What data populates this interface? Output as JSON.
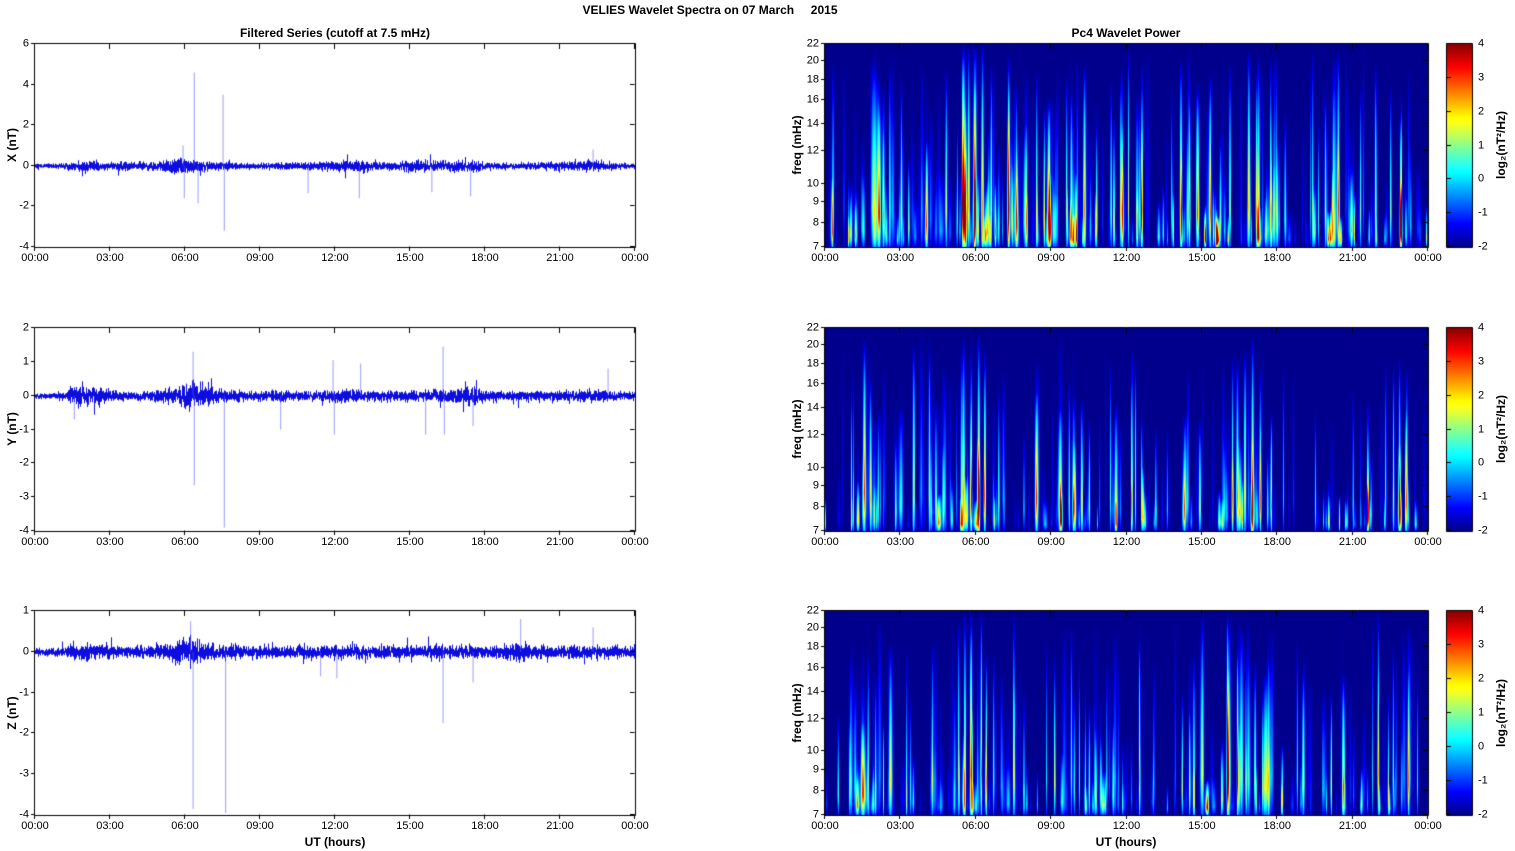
{
  "figure": {
    "title": "VELIES Wavelet Spectra on 07 March     2015"
  },
  "x_axis": {
    "label": "UT (hours)",
    "ticks": [
      "00:00",
      "03:00",
      "06:00",
      "09:00",
      "12:00",
      "15:00",
      "18:00",
      "21:00",
      "00:00"
    ],
    "range_hours": [
      0,
      24
    ]
  },
  "colorbar": {
    "label": "log₂(nT²/Hz)",
    "ticks": [
      4,
      3,
      2,
      1,
      0,
      -1,
      -2
    ],
    "min": -2,
    "max": 4,
    "colormap": "jet"
  },
  "chart_data": [
    {
      "id": "series-x",
      "type": "line",
      "title": "Filtered Series (cutoff at 7.5 mHz)",
      "ylabel": "X (nT)",
      "ylim": [
        -4,
        6
      ],
      "yticks": [
        6,
        4,
        2,
        0,
        -2,
        -4
      ],
      "line_color": "#0000dd",
      "seed": 7,
      "noise_envelope": [
        [
          0,
          0.09
        ],
        [
          1,
          0.1
        ],
        [
          1.4,
          0.18
        ],
        [
          1.8,
          0.26
        ],
        [
          2.4,
          0.22
        ],
        [
          3,
          0.16
        ],
        [
          3.6,
          0.2
        ],
        [
          4.2,
          0.16
        ],
        [
          5,
          0.24
        ],
        [
          5.6,
          0.38
        ],
        [
          6.1,
          0.32
        ],
        [
          6.6,
          0.26
        ],
        [
          7.2,
          0.18
        ],
        [
          8,
          0.15
        ],
        [
          9,
          0.13
        ],
        [
          10,
          0.16
        ],
        [
          11,
          0.16
        ],
        [
          11.6,
          0.2
        ],
        [
          12.2,
          0.26
        ],
        [
          12.8,
          0.28
        ],
        [
          13.4,
          0.2
        ],
        [
          14,
          0.17
        ],
        [
          14.6,
          0.2
        ],
        [
          15.2,
          0.24
        ],
        [
          15.8,
          0.26
        ],
        [
          16.4,
          0.22
        ],
        [
          17,
          0.26
        ],
        [
          17.4,
          0.3
        ],
        [
          18,
          0.16
        ],
        [
          19,
          0.13
        ],
        [
          20,
          0.15
        ],
        [
          21,
          0.16
        ],
        [
          21.6,
          0.2
        ],
        [
          22.2,
          0.24
        ],
        [
          22.7,
          0.2
        ],
        [
          23.2,
          0.14
        ],
        [
          24,
          0.12
        ]
      ],
      "spikes_t_val": [
        [
          5.9,
          1.0
        ],
        [
          5.95,
          -1.6
        ],
        [
          6.35,
          4.6
        ],
        [
          6.5,
          -1.85
        ],
        [
          7.5,
          3.5
        ],
        [
          7.55,
          -3.2
        ],
        [
          10.9,
          -1.35
        ],
        [
          12.95,
          -1.6
        ],
        [
          15.85,
          -1.3
        ],
        [
          17.4,
          -1.5
        ],
        [
          22.3,
          0.8
        ]
      ]
    },
    {
      "id": "series-y",
      "type": "line",
      "title": "",
      "ylabel": "Y (nT)",
      "ylim": [
        -4,
        2
      ],
      "yticks": [
        2,
        1,
        0,
        -1,
        -2,
        -3,
        -4
      ],
      "line_color": "#0000dd",
      "seed": 8,
      "noise_envelope": [
        [
          0,
          0.07
        ],
        [
          1.2,
          0.08
        ],
        [
          1.5,
          0.24
        ],
        [
          1.9,
          0.3
        ],
        [
          2.4,
          0.24
        ],
        [
          3,
          0.16
        ],
        [
          3.8,
          0.12
        ],
        [
          4.6,
          0.12
        ],
        [
          5.4,
          0.18
        ],
        [
          5.9,
          0.28
        ],
        [
          6.3,
          0.34
        ],
        [
          6.8,
          0.28
        ],
        [
          7.4,
          0.16
        ],
        [
          8,
          0.13
        ],
        [
          9,
          0.13
        ],
        [
          9.6,
          0.16
        ],
        [
          10.2,
          0.13
        ],
        [
          11,
          0.13
        ],
        [
          11.8,
          0.16
        ],
        [
          12.4,
          0.18
        ],
        [
          13,
          0.16
        ],
        [
          14,
          0.13
        ],
        [
          15,
          0.13
        ],
        [
          16,
          0.16
        ],
        [
          16.6,
          0.2
        ],
        [
          17.2,
          0.22
        ],
        [
          17.6,
          0.24
        ],
        [
          18.2,
          0.15
        ],
        [
          19,
          0.11
        ],
        [
          20,
          0.12
        ],
        [
          21,
          0.13
        ],
        [
          21.8,
          0.15
        ],
        [
          22.4,
          0.18
        ],
        [
          23,
          0.13
        ],
        [
          24,
          0.1
        ]
      ],
      "spikes_t_val": [
        [
          1.55,
          -0.7
        ],
        [
          6.3,
          1.3
        ],
        [
          6.35,
          -2.65
        ],
        [
          7.55,
          -3.9
        ],
        [
          9.8,
          -1.0
        ],
        [
          11.9,
          1.05
        ],
        [
          11.95,
          -1.15
        ],
        [
          13.0,
          0.95
        ],
        [
          15.6,
          -1.15
        ],
        [
          16.3,
          1.45
        ],
        [
          16.35,
          -1.15
        ],
        [
          17.5,
          -0.9
        ],
        [
          22.9,
          0.8
        ]
      ]
    },
    {
      "id": "series-z",
      "type": "line",
      "title": "",
      "ylabel": "Z (nT)",
      "ylim": [
        -4,
        1
      ],
      "yticks": [
        1,
        0,
        -1,
        -2,
        -3,
        -4
      ],
      "line_color": "#0000dd",
      "seed": 9,
      "noise_envelope": [
        [
          0,
          0.08
        ],
        [
          1,
          0.1
        ],
        [
          1.5,
          0.16
        ],
        [
          2,
          0.18
        ],
        [
          2.6,
          0.15
        ],
        [
          3.4,
          0.12
        ],
        [
          4.2,
          0.13
        ],
        [
          5,
          0.16
        ],
        [
          5.6,
          0.24
        ],
        [
          6.1,
          0.3
        ],
        [
          6.6,
          0.22
        ],
        [
          7.2,
          0.16
        ],
        [
          8,
          0.14
        ],
        [
          9,
          0.13
        ],
        [
          10,
          0.14
        ],
        [
          11,
          0.13
        ],
        [
          12,
          0.14
        ],
        [
          13,
          0.15
        ],
        [
          14,
          0.13
        ],
        [
          15,
          0.13
        ],
        [
          16,
          0.16
        ],
        [
          17,
          0.16
        ],
        [
          18,
          0.13
        ],
        [
          19,
          0.16
        ],
        [
          19.6,
          0.2
        ],
        [
          20.2,
          0.14
        ],
        [
          21,
          0.13
        ],
        [
          22,
          0.15
        ],
        [
          23,
          0.13
        ],
        [
          24,
          0.11
        ]
      ],
      "spikes_t_val": [
        [
          6.2,
          0.75
        ],
        [
          6.3,
          -3.85
        ],
        [
          7.6,
          -3.95
        ],
        [
          11.4,
          -0.6
        ],
        [
          12.05,
          -0.65
        ],
        [
          16.3,
          -1.75
        ],
        [
          17.5,
          -0.75
        ],
        [
          19.4,
          0.8
        ],
        [
          22.3,
          0.6
        ]
      ]
    },
    {
      "id": "spec-x",
      "type": "heatmap",
      "title": "Pc4 Wavelet Power",
      "ylabel": "freq (mHz)",
      "yscale": "log",
      "ylim": [
        7,
        22
      ],
      "yticks": [
        22,
        20,
        18,
        16,
        14,
        12,
        10,
        9,
        8,
        7
      ],
      "clim": [
        -2,
        4
      ],
      "seed": 41,
      "n_streaks": 300,
      "intensity": 1.15,
      "activity_hourly": [
        0.35,
        0.75,
        0.9,
        0.6,
        0.55,
        0.95,
        1.0,
        0.85,
        0.55,
        0.75,
        0.85,
        0.8,
        0.65,
        0.5,
        0.75,
        0.8,
        0.9,
        0.85,
        0.55,
        0.5,
        0.65,
        0.75,
        0.8,
        0.55
      ],
      "streak_events_t_amp_h_w": [
        [
          1.9,
          3.8,
          0.92,
          1.6
        ],
        [
          2.1,
          3.4,
          0.85,
          1.2
        ],
        [
          2.3,
          3.2,
          0.8,
          0.9
        ],
        [
          5.5,
          5.6,
          1,
          1.1
        ],
        [
          5.7,
          5.2,
          1,
          0.8
        ],
        [
          5.95,
          6.0,
          1,
          1.2
        ],
        [
          6.25,
          5.4,
          1,
          0.9
        ],
        [
          6.6,
          4.4,
          0.9,
          0.7
        ],
        [
          7.3,
          5.0,
          0.95,
          0.8
        ],
        [
          7.6,
          4.2,
          0.8,
          0.6
        ],
        [
          8.9,
          3.4,
          0.7,
          0.6
        ],
        [
          9.6,
          3.8,
          0.85,
          0.7
        ],
        [
          10.3,
          4.4,
          0.9,
          0.8
        ],
        [
          10.8,
          3.6,
          0.6,
          0.5
        ],
        [
          11.8,
          3.5,
          0.9,
          0.6
        ],
        [
          12.4,
          3.8,
          0.75,
          0.7
        ],
        [
          12.6,
          4.4,
          0.9,
          0.6
        ],
        [
          14.15,
          5.2,
          0.92,
          0.9
        ],
        [
          14.5,
          3.6,
          0.7,
          0.5
        ],
        [
          15.3,
          4.0,
          0.85,
          0.7
        ],
        [
          16.1,
          4.2,
          0.9,
          0.7
        ],
        [
          16.85,
          5.3,
          0.97,
          0.9
        ],
        [
          17.15,
          4.4,
          0.85,
          0.6
        ],
        [
          19.9,
          3.4,
          0.75,
          0.5
        ],
        [
          21.3,
          3.6,
          0.8,
          0.6
        ],
        [
          21.9,
          4.4,
          0.9,
          0.7
        ],
        [
          22.5,
          4.0,
          0.8,
          0.6
        ],
        [
          22.9,
          4.3,
          0.65,
          0.6
        ],
        [
          23.3,
          3.2,
          0.5,
          0.5
        ]
      ]
    },
    {
      "id": "spec-y",
      "type": "heatmap",
      "title": "",
      "ylabel": "freq (mHz)",
      "yscale": "log",
      "ylim": [
        7,
        22
      ],
      "yticks": [
        22,
        20,
        18,
        16,
        14,
        12,
        10,
        9,
        8,
        7
      ],
      "clim": [
        -2,
        4
      ],
      "seed": 42,
      "n_streaks": 230,
      "intensity": 1.0,
      "activity_hourly": [
        0.3,
        0.8,
        0.7,
        0.5,
        0.4,
        0.85,
        0.9,
        0.55,
        0.4,
        0.65,
        0.7,
        0.6,
        0.55,
        0.45,
        0.5,
        0.55,
        0.85,
        0.8,
        0.45,
        0.35,
        0.45,
        0.5,
        0.7,
        0.6
      ],
      "streak_events_t_amp_h_w": [
        [
          1.55,
          5.4,
          0.95,
          1.0
        ],
        [
          1.8,
          4.6,
          0.75,
          0.7
        ],
        [
          2.1,
          3.6,
          0.6,
          0.6
        ],
        [
          5.5,
          4.6,
          0.95,
          0.9
        ],
        [
          5.8,
          4.2,
          0.9,
          0.7
        ],
        [
          6.1,
          5.4,
          0.97,
          0.9
        ],
        [
          6.35,
          4.8,
          0.9,
          0.7
        ],
        [
          6.9,
          3.8,
          0.7,
          0.6
        ],
        [
          7.9,
          3.0,
          0.5,
          0.5
        ],
        [
          9.7,
          3.6,
          0.75,
          0.6
        ],
        [
          10.2,
          4.6,
          0.65,
          0.8
        ],
        [
          10.5,
          3.8,
          0.55,
          0.6
        ],
        [
          12.2,
          4.0,
          0.9,
          0.6
        ],
        [
          12.6,
          3.2,
          0.55,
          0.5
        ],
        [
          13.6,
          2.8,
          0.5,
          0.5
        ],
        [
          16.4,
          4.4,
          0.85,
          0.8
        ],
        [
          16.7,
          5.0,
          0.9,
          0.8
        ],
        [
          17.0,
          5.4,
          0.95,
          0.9
        ],
        [
          17.3,
          4.2,
          0.8,
          0.6
        ],
        [
          19.5,
          2.8,
          0.6,
          0.5
        ],
        [
          21.0,
          3.0,
          0.7,
          0.5
        ],
        [
          22.3,
          3.4,
          0.85,
          0.5
        ],
        [
          22.85,
          4.5,
          0.85,
          0.7
        ],
        [
          23.1,
          4.0,
          0.6,
          0.6
        ]
      ]
    },
    {
      "id": "spec-z",
      "type": "heatmap",
      "title": "",
      "ylabel": "freq (mHz)",
      "yscale": "log",
      "ylim": [
        7,
        22
      ],
      "yticks": [
        22,
        20,
        18,
        16,
        14,
        12,
        10,
        9,
        8,
        7
      ],
      "clim": [
        -2,
        4
      ],
      "seed": 43,
      "n_streaks": 240,
      "intensity": 0.95,
      "activity_hourly": [
        0.35,
        0.65,
        0.6,
        0.5,
        0.5,
        0.9,
        0.8,
        0.6,
        0.55,
        0.6,
        0.65,
        0.6,
        0.55,
        0.5,
        0.6,
        0.55,
        0.75,
        0.7,
        0.5,
        0.5,
        0.55,
        0.55,
        0.7,
        0.55
      ],
      "streak_events_t_amp_h_w": [
        [
          1.7,
          3.6,
          0.8,
          0.7
        ],
        [
          2.0,
          3.4,
          0.7,
          0.6
        ],
        [
          5.3,
          4.0,
          0.95,
          0.7
        ],
        [
          5.55,
          4.8,
          1,
          0.8
        ],
        [
          5.8,
          5.0,
          1,
          0.8
        ],
        [
          6.2,
          5.8,
          1,
          0.55
        ],
        [
          6.4,
          5.0,
          0.8,
          0.6
        ],
        [
          6.7,
          4.0,
          0.8,
          0.5
        ],
        [
          7.5,
          5.2,
          1,
          0.5
        ],
        [
          7.9,
          3.6,
          0.6,
          0.5
        ],
        [
          9.9,
          3.4,
          0.6,
          0.6
        ],
        [
          10.5,
          3.8,
          0.55,
          0.6
        ],
        [
          11.2,
          3.2,
          0.75,
          0.5
        ],
        [
          12.5,
          3.4,
          0.85,
          0.5
        ],
        [
          14.2,
          4.2,
          0.6,
          0.6
        ],
        [
          14.5,
          3.6,
          0.5,
          0.5
        ],
        [
          16.0,
          5.0,
          1,
          0.55
        ],
        [
          16.4,
          4.0,
          0.8,
          0.6
        ],
        [
          17.1,
          4.4,
          0.75,
          0.7
        ],
        [
          17.4,
          3.6,
          0.6,
          0.5
        ],
        [
          19.8,
          3.2,
          0.6,
          0.5
        ],
        [
          20.6,
          3.4,
          0.7,
          0.5
        ],
        [
          22.0,
          4.8,
          1,
          0.55
        ],
        [
          22.4,
          3.6,
          0.6,
          0.5
        ],
        [
          23.2,
          3.4,
          0.7,
          0.5
        ]
      ]
    }
  ]
}
